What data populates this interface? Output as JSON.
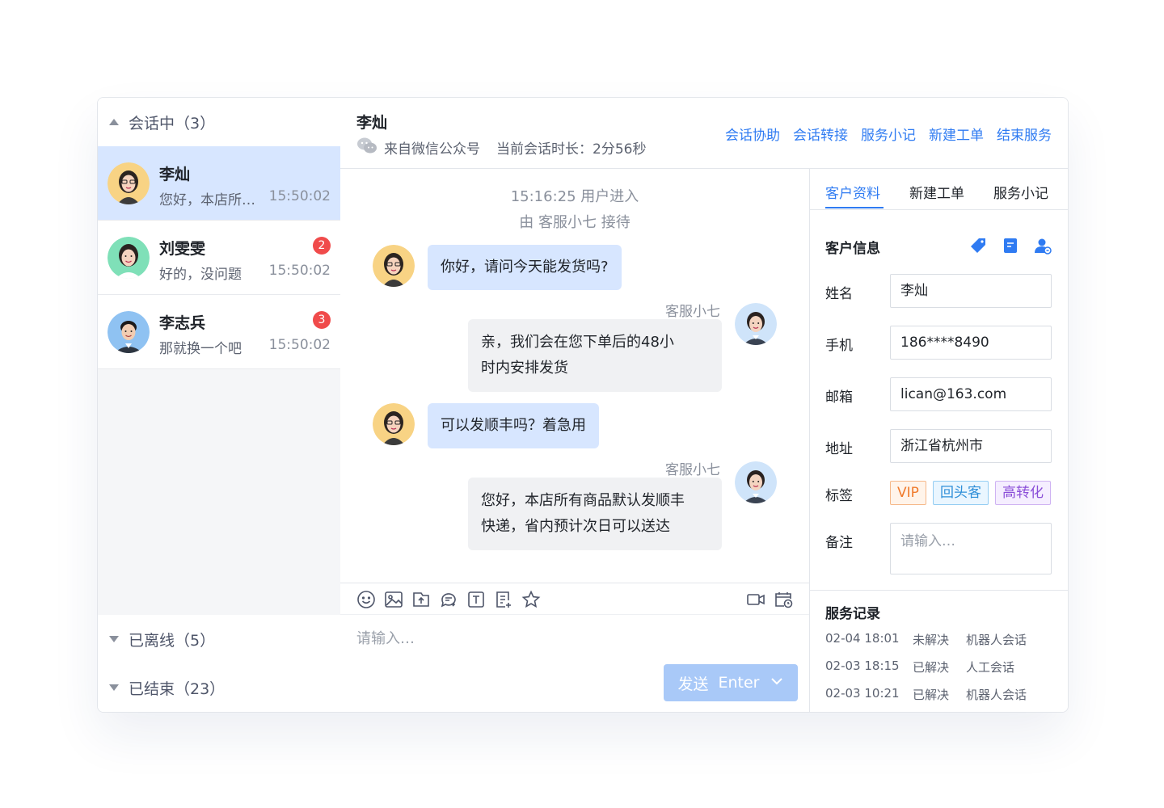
{
  "left": {
    "active_group": {
      "label": "会话中（3）"
    },
    "conversations": [
      {
        "name": "李灿",
        "preview": "您好，本店所…",
        "time": "15:50:02",
        "badge": ""
      },
      {
        "name": "刘雯雯",
        "preview": "好的，没问题",
        "time": "15:50:02",
        "badge": "2"
      },
      {
        "name": "李志兵",
        "preview": "那就换一个吧",
        "time": "15:50:02",
        "badge": "3"
      }
    ],
    "offline_group": {
      "label": "已离线（5）"
    },
    "ended_group": {
      "label": "已结束（23）"
    }
  },
  "header": {
    "name": "李灿",
    "source": "来自微信公众号",
    "duration": "当前会话时长：2分56秒",
    "actions": [
      "会话协助",
      "会话转接",
      "服务小记",
      "新建工单",
      "结束服务"
    ]
  },
  "chat": {
    "system_line1": "15:16:25 用户进入",
    "system_line2": "由 客服小七 接待",
    "agent_name": "客服小七",
    "messages": [
      {
        "from": "user",
        "text": "你好，请问今天能发货吗?"
      },
      {
        "from": "agent",
        "line1": "亲，我们会在您下单后的48小",
        "line2": "时内安排发货"
      },
      {
        "from": "user",
        "text": "可以发顺丰吗？着急用"
      },
      {
        "from": "agent",
        "line1": "您好，本店所有商品默认发顺丰",
        "line2": "快递，省内预计次日可以送达"
      }
    ]
  },
  "input": {
    "placeholder": "请输入…",
    "send_label": "发送",
    "send_key": "Enter",
    "toolbar_icons": [
      "emoji-icon",
      "image-icon",
      "upload-icon",
      "quick-reply-icon",
      "text-icon",
      "form-icon",
      "star-icon"
    ],
    "toolbar_right_icons": [
      "video-icon",
      "schedule-icon"
    ]
  },
  "right": {
    "tabs": [
      "客户资料",
      "新建工单",
      "服务小记"
    ],
    "section_title": "客户信息",
    "fields": {
      "name_label": "姓名",
      "name_value": "李灿",
      "phone_label": "手机",
      "phone_value": "186****8490",
      "email_label": "邮箱",
      "email_value": "lican@163.com",
      "address_label": "地址",
      "address_value": "浙江省杭州市",
      "tags_label": "标签",
      "note_label": "备注",
      "note_placeholder": "请输入…"
    },
    "tags": [
      {
        "text": "VIP",
        "color": "#f07a2b",
        "bg": "#fff4ea"
      },
      {
        "text": "回头客",
        "color": "#2f8fd8",
        "bg": "#eaf6ff"
      },
      {
        "text": "高转化",
        "color": "#8b4fd8",
        "bg": "#f5eeff"
      }
    ],
    "records_title": "服务记录",
    "records": [
      {
        "time": "02-04 18:01",
        "status": "未解决",
        "type": "机器人会话"
      },
      {
        "time": "02-03 18:15",
        "status": "已解决",
        "type": "人工会话"
      },
      {
        "time": "02-03 10:21",
        "status": "已解决",
        "type": "机器人会话"
      }
    ]
  },
  "colors": {
    "accent": "#2f7bf2",
    "active_bg": "#d7e6ff",
    "badge": "#f04b4b"
  }
}
